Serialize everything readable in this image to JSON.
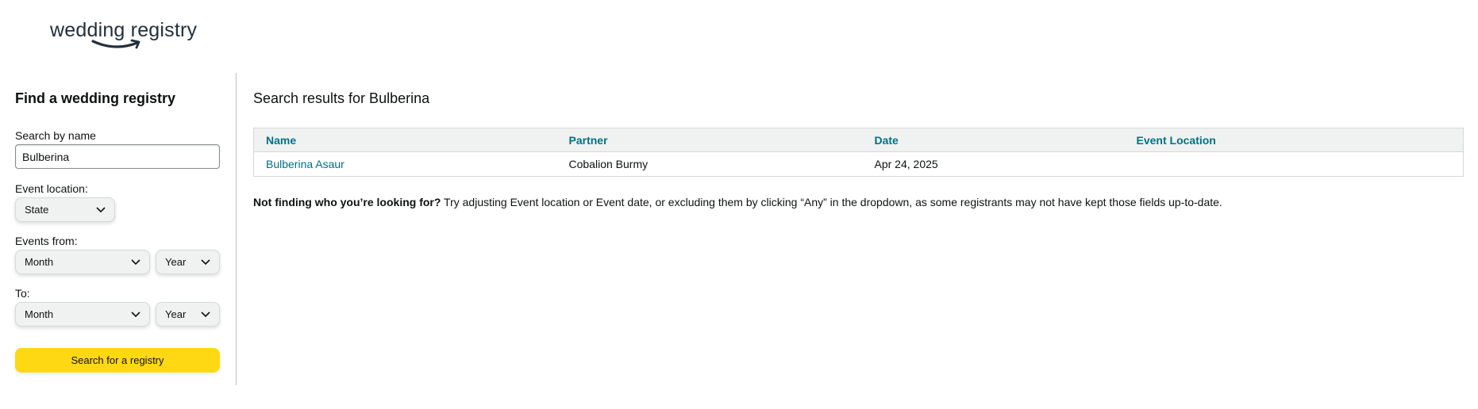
{
  "logo": {
    "text": "wedding registry",
    "icon": "amazon-smile-arrow"
  },
  "sidebar": {
    "title": "Find a wedding registry",
    "name_label": "Search by name",
    "name_value": "Bulberina",
    "location_label": "Event location:",
    "state_select": "State",
    "from_label": "Events from:",
    "from_month": "Month",
    "from_year": "Year",
    "to_label": "To:",
    "to_month": "Month",
    "to_year": "Year",
    "search_button": "Search for a registry"
  },
  "results": {
    "title": "Search results for Bulberina",
    "columns": [
      "Name",
      "Partner",
      "Date",
      "Event Location"
    ],
    "rows": [
      {
        "name": "Bulberina Asaur",
        "partner": "Cobalion Burmy",
        "date": "Apr 24, 2025",
        "location": ""
      }
    ],
    "help_bold": "Not finding who you’re looking for?",
    "help_text": " Try adjusting Event location or Event date, or excluding them by clicking “Any” in the dropdown, as some registrants may not have kept those fields up-to-date."
  },
  "colors": {
    "link": "#007185",
    "button": "#ffd814",
    "header_bg": "#f0f2f2"
  }
}
